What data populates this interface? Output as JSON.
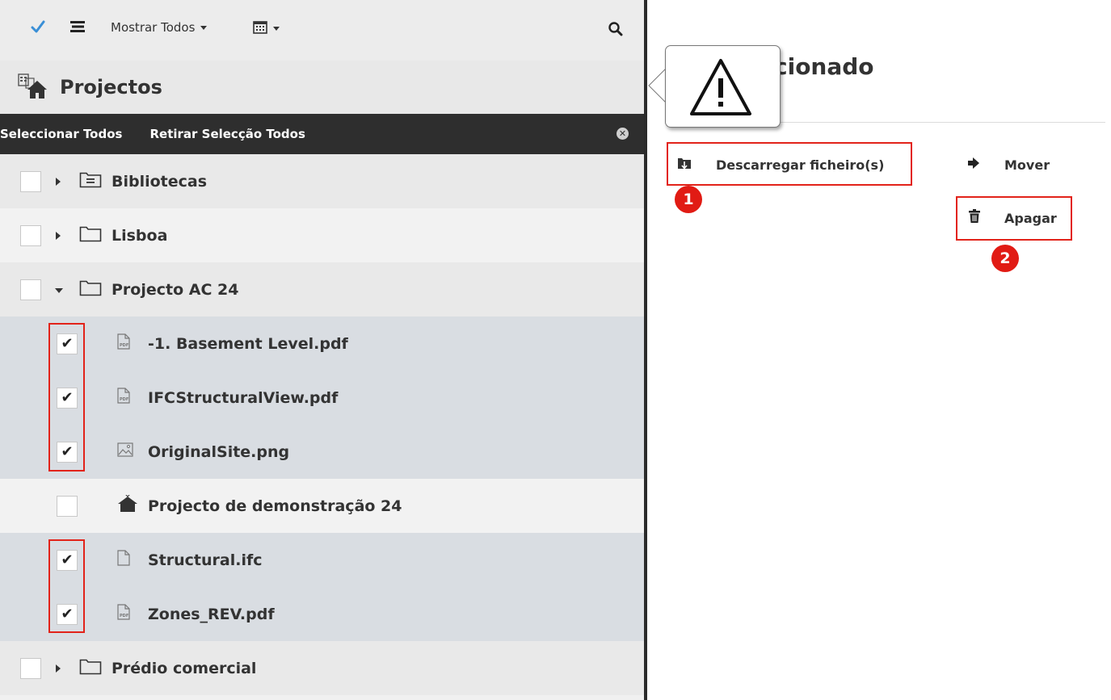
{
  "toolbar": {
    "show_all_label": "Mostrar Todos",
    "icons": [
      "check-icon",
      "list-icon",
      "calendar-icon",
      "search-icon"
    ]
  },
  "sidebar": {
    "title": "Projectos",
    "select_all": "Seleccionar Todos",
    "deselect_all": "Retirar Selecção Todos",
    "close_symbol": "✕",
    "items": [
      {
        "label": "Bibliotecas",
        "level": 0,
        "type": "library-folder",
        "checked": false,
        "expandable": true
      },
      {
        "label": "Lisboa",
        "level": 0,
        "type": "folder",
        "checked": false,
        "expandable": true
      },
      {
        "label": "Projecto AC 24",
        "level": 0,
        "type": "folder",
        "checked": false,
        "expandable": true,
        "expanded": true
      },
      {
        "label": "-1. Basement Level.pdf",
        "level": 1,
        "type": "pdf",
        "checked": true
      },
      {
        "label": "IFCStructuralView.pdf",
        "level": 1,
        "type": "pdf",
        "checked": true
      },
      {
        "label": "OriginalSite.png",
        "level": 1,
        "type": "image",
        "checked": true
      },
      {
        "label": "Projecto de demonstração 24",
        "level": 1,
        "type": "project",
        "checked": false
      },
      {
        "label": "Structural.ifc",
        "level": 1,
        "type": "file",
        "checked": true
      },
      {
        "label": "Zones_REV.pdf",
        "level": 1,
        "type": "pdf",
        "checked": true
      },
      {
        "label": "Prédio comercial",
        "level": 0,
        "type": "folder",
        "checked": false,
        "expandable": true
      }
    ]
  },
  "main": {
    "title_fragment": "cionado",
    "actions": {
      "download": "Descarregar ficheiro(s)",
      "move": "Mover",
      "delete": "Apagar"
    },
    "badges": [
      "1",
      "2"
    ]
  },
  "colors": {
    "highlight": "#e2231a",
    "badge": "#e11b14",
    "dark_bar": "#2e2e2e",
    "selected_row": "#d9dde2"
  }
}
